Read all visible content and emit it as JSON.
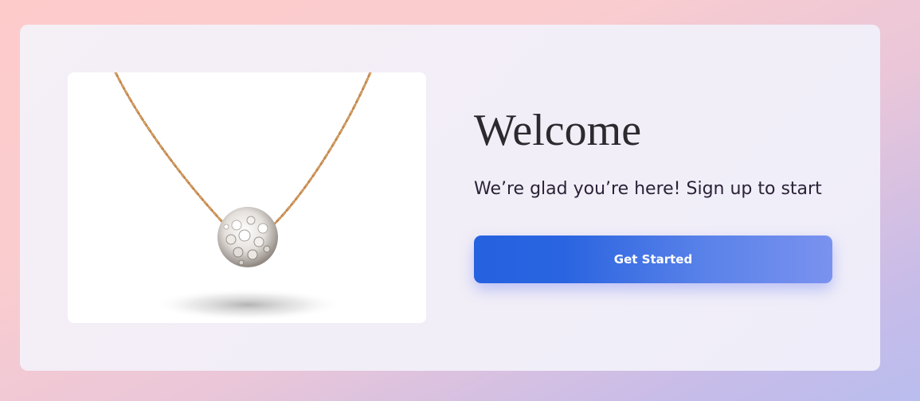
{
  "welcome": {
    "title": "Welcome",
    "subtitle": "We’re glad you’re here! Sign up to start",
    "cta_label": "Get Started"
  },
  "hero_image": {
    "subject": "necklace-with-crystal-ball-pendant"
  },
  "colors": {
    "button_gradient_start": "#2562df",
    "button_gradient_end": "#7a92ef",
    "title_color": "#2c2a2e",
    "subtitle_color": "#2b2238"
  }
}
